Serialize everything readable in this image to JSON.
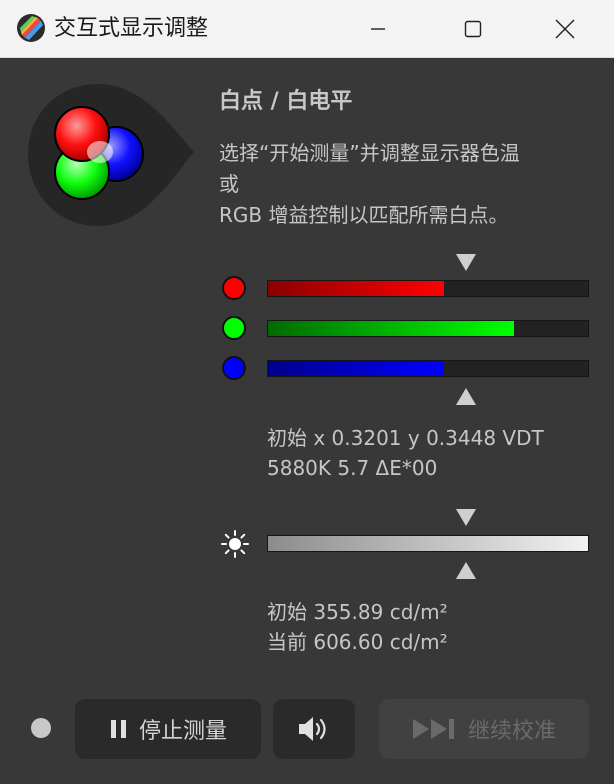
{
  "window": {
    "title": "交互式显示调整"
  },
  "main": {
    "heading": "白点 / 白电平",
    "description_lines": [
      "选择“开始测量”并调整显示器色温",
      "或",
      "RGB 增益控制以匹配所需白点。"
    ]
  },
  "rgb_gains": {
    "red": 0.55,
    "green": 0.77,
    "blue": 0.55,
    "target": 0.62
  },
  "colors": {
    "red": "#ff0000",
    "green": "#00ff00",
    "blue": "#0000ff"
  },
  "white_point_readout": {
    "line1": "初始 x 0.3201 y 0.3448 VDT",
    "line2": "5880K 5.7 ΔE*00"
  },
  "luminance": {
    "target": 0.62,
    "line1": "初始 355.89 cd/m²",
    "line2": "当前 606.60 cd/m²"
  },
  "footer": {
    "stop_label": "停止测量",
    "continue_label": "继续校准"
  },
  "icons": {
    "app": "color-wheel-icon",
    "minimize": "minimize-icon",
    "maximize": "maximize-icon",
    "close": "close-icon",
    "brightness": "sun-icon",
    "pause": "pause-icon",
    "speaker": "speaker-icon",
    "skip": "skip-forward-icon"
  }
}
